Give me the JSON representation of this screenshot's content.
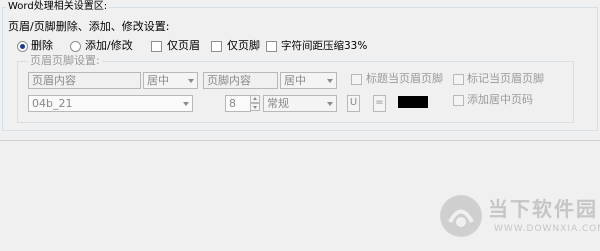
{
  "section": {
    "title": "Word处理相关设置区:",
    "subtitle": "页眉/页脚删除、添加、修改设置:",
    "options": {
      "delete_label": "删除",
      "add_modify_label": "添加/修改",
      "header_only_label": "仅页眉",
      "footer_only_label": "仅页脚",
      "compress_label": "字符间距压缩33%",
      "selected_mode": "删除"
    },
    "hf_settings": {
      "legend": "页眉页脚设置:",
      "header_content": "页眉内容",
      "header_align": "居中",
      "footer_content": "页脚内容",
      "footer_align": "居中",
      "title_as_header_label": "标题当页眉页脚",
      "mark_as_header_label": "标记当页眉页脚",
      "add_page_number_label": "添加居中页码",
      "font_name": "04b_21",
      "font_size": "8",
      "font_style": "常规",
      "underline_label": "U",
      "equals_label": "=",
      "color": "#000000"
    }
  },
  "watermark": {
    "brand": "当下软件园",
    "url": "WWW.DOWNXIA.COM"
  }
}
